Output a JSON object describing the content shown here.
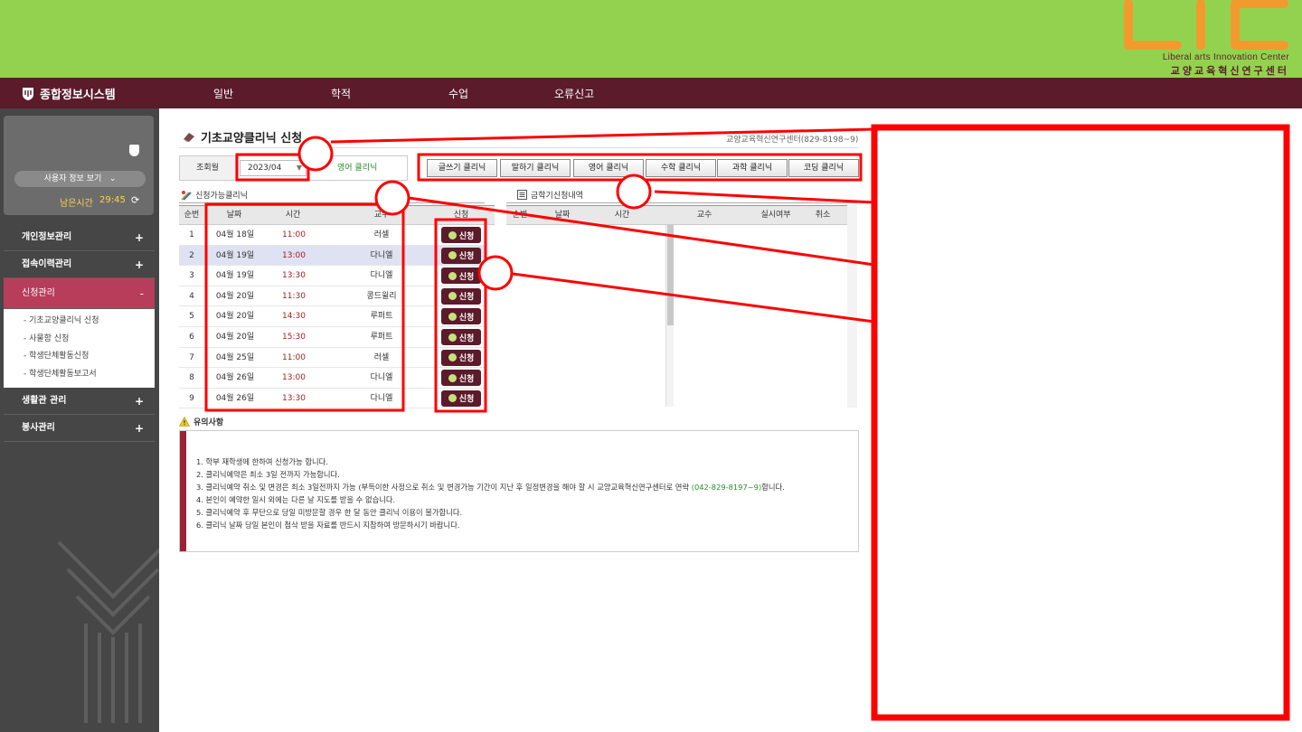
{
  "header": {
    "logo_sub_en": "Liberal arts Innovation Center",
    "logo_sub_kr": "교양교육혁신연구센터"
  },
  "nav": {
    "brand": "종합정보시스템",
    "items": [
      "일반",
      "학적",
      "수업",
      "오류신고"
    ]
  },
  "sidebar": {
    "user_button": "사용자 정보 보기",
    "time_label": "남은시간",
    "time_value": "29:45",
    "menu": [
      {
        "label": "개인정보관리",
        "icon": "+"
      },
      {
        "label": "접속이력관리",
        "icon": "+"
      },
      {
        "label": "신청관리",
        "icon": "-"
      },
      {
        "label": "생활관 관리",
        "icon": "+"
      },
      {
        "label": "봉사관리",
        "icon": "+"
      }
    ],
    "submenu": [
      "- 기초교양클리닉 신청",
      "- 사물함 신청",
      "- 학생단체활동신청",
      "- 학생단체활동보고서"
    ]
  },
  "page": {
    "title": "기초교양클리닉 신청",
    "org": "교양교육혁신연구센터(829-8198~9)"
  },
  "filter": {
    "label": "조회월",
    "value": "2023/04",
    "current": "영어 클리닉"
  },
  "clinics": [
    "글쓰기 클리닉",
    "말하기 클리닉",
    "영어 클리닉",
    "수학 클리닉",
    "과학 클리닉",
    "코딩 클리닉"
  ],
  "available": {
    "label": "신청가능클리닉",
    "headers": [
      "순번",
      "날짜",
      "시간",
      "교수",
      "신청"
    ],
    "button_label": "신청",
    "rows": [
      {
        "no": "1",
        "date": "04월 18일",
        "time": "11:00",
        "prof": "러셀"
      },
      {
        "no": "2",
        "date": "04월 19일",
        "time": "13:00",
        "prof": "다니엘"
      },
      {
        "no": "3",
        "date": "04월 19일",
        "time": "13:30",
        "prof": "다니엘"
      },
      {
        "no": "4",
        "date": "04월 20일",
        "time": "11:30",
        "prof": "콩드윌리"
      },
      {
        "no": "5",
        "date": "04월 20일",
        "time": "14:30",
        "prof": "루퍼트"
      },
      {
        "no": "6",
        "date": "04월 20일",
        "time": "15:30",
        "prof": "루퍼트"
      },
      {
        "no": "7",
        "date": "04월 25일",
        "time": "11:00",
        "prof": "러셀"
      },
      {
        "no": "8",
        "date": "04월 26일",
        "time": "13:00",
        "prof": "다니엘"
      },
      {
        "no": "9",
        "date": "04월 26일",
        "time": "13:30",
        "prof": "다니엘"
      }
    ]
  },
  "history": {
    "label": "금학기신청내역",
    "headers": [
      "순번",
      "날짜",
      "시간",
      "교수",
      "실시여부",
      "취소"
    ]
  },
  "notice": {
    "title": "유의사항",
    "lines": [
      "1. 학부 재학생에 한하여 신청가능 합니다.",
      "2. 클리닉예약은 최소 3일 전까지 가능합니다.",
      "3. 클리닉예약 취소 및 변경은 최소 3일전까지 가능 (부득이한 사정으로 취소 및 변경가능 기간이 지난 후 일정변경을 해야 할 시 교양교육혁신연구센터로 연락 (042-829-8197~9)합니다.",
      "4. 본인이 예약한 일시 외에는 다른 날 지도를 받을 수 없습니다.",
      "5. 클리닉예약 후 무단으로 당일 미방문할 경우 한 달 동안 클리닉 이용이 불가합니다.",
      "6. 클리닉 날짜 당일 본인이 첨삭 받을 자료를 반드시 지참하여 방문하시기 바랍니다."
    ],
    "phone": "(042-829-8197~9)"
  },
  "colors": {
    "banner": "#93d24f",
    "navbar": "#5b1b2a",
    "sidebar": "#464646",
    "active_menu": "#b83d5a",
    "annotation": "#ff0000"
  }
}
